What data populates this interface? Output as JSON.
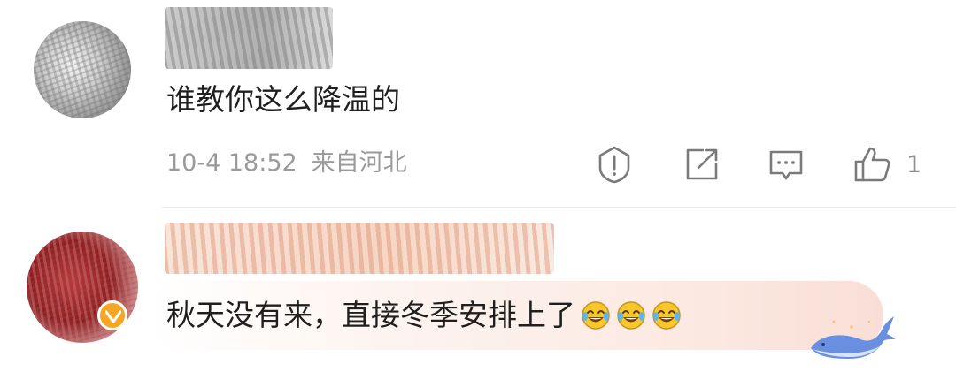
{
  "comments": [
    {
      "text": "谁教你这么降温的",
      "meta": {
        "date": "10-4 18:52",
        "location": "来自河北"
      },
      "actions": {
        "report_icon": "report-icon",
        "share_icon": "share-icon",
        "reply_icon": "reply-icon",
        "like_icon": "thumbs-up-icon",
        "like_count": "1"
      }
    },
    {
      "text": "秋天没有来，直接冬季安排上了",
      "emoji": [
        "laugh-cry-emoji",
        "laugh-cry-emoji",
        "laugh-cry-emoji"
      ],
      "badge": "verified-badge",
      "decoration": "whale-icon"
    }
  ],
  "colors": {
    "text": "#1f1f1f",
    "meta": "#9a9a9a",
    "badge": "#f6a623",
    "bubble": "#fbe7df"
  }
}
